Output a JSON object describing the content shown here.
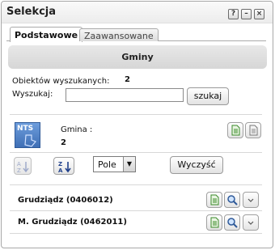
{
  "window": {
    "title": "Selekcja"
  },
  "window_controls": {
    "help": "?",
    "minimize": "–",
    "close": "×"
  },
  "tabs": [
    {
      "label": "Podstawowe",
      "active": true
    },
    {
      "label": "Zaawansowane",
      "active": false
    }
  ],
  "section": {
    "title": "Gminy"
  },
  "search": {
    "found_label": "Obiektów wyszukanych:",
    "found_count": "2",
    "search_label": "Wyszukaj:",
    "search_value": "",
    "search_button": "szukaj"
  },
  "layer": {
    "badge": "NTS",
    "name_label": "Gmina :",
    "count": "2"
  },
  "sort": {
    "field_value": "Pole",
    "clear_button": "Wyczyść"
  },
  "results": [
    {
      "label": "Grudziądz (0406012)"
    },
    {
      "label": "M. Grudziądz (0462011)"
    }
  ],
  "colors": {
    "doc_icon_green": "#3a8a2a",
    "accent_blue": "#2f5a99"
  }
}
